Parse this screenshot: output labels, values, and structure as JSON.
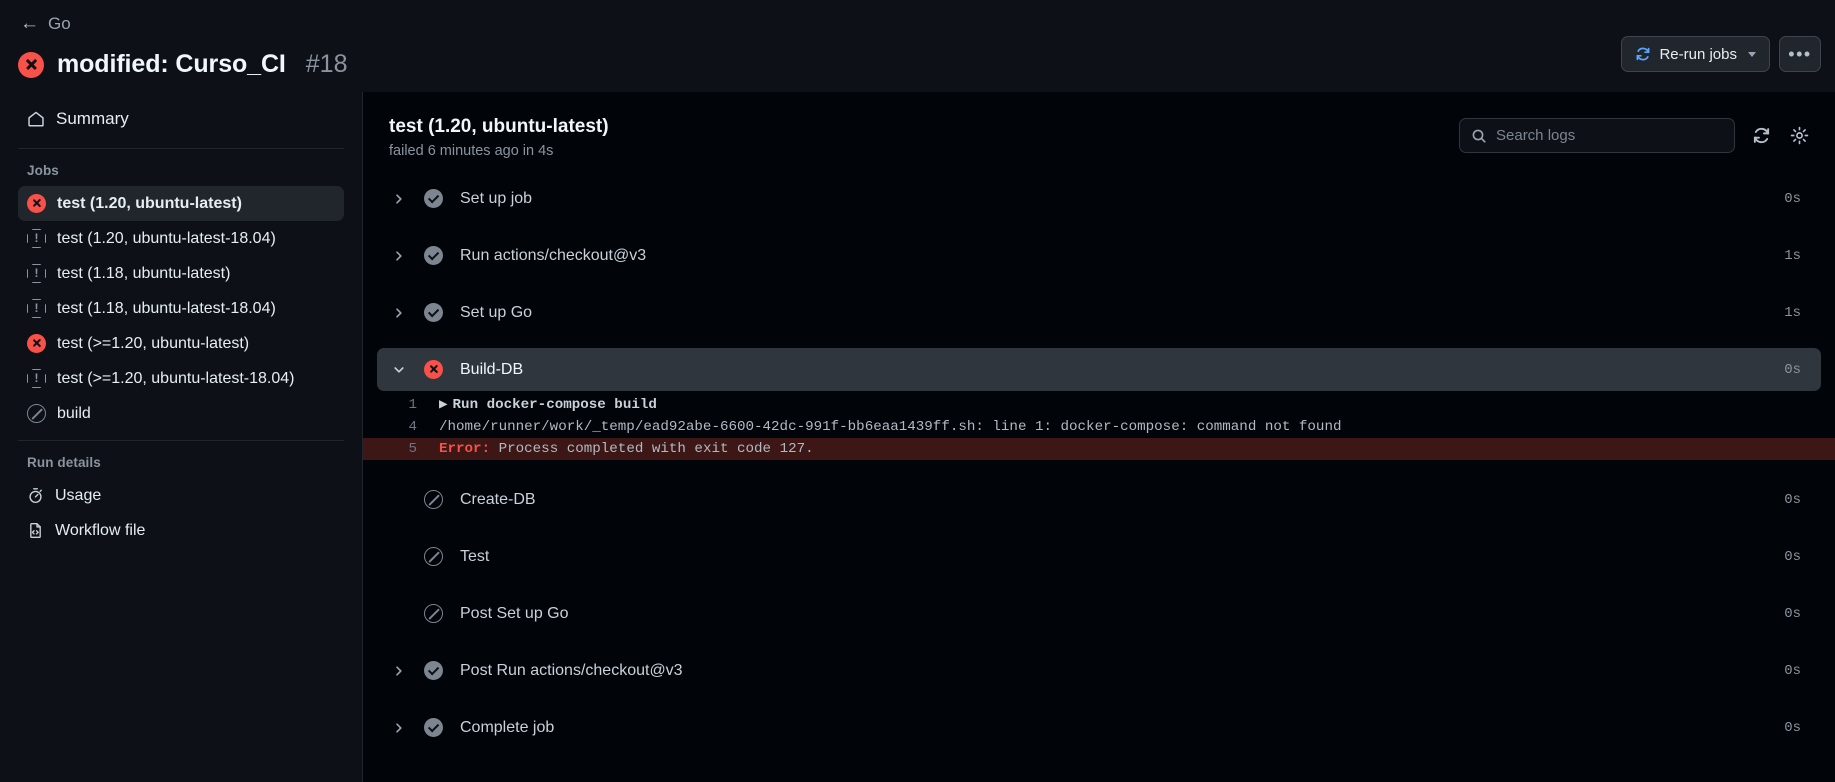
{
  "header": {
    "back_arrow_glyph": "←",
    "back_label": "Go",
    "run_title": "modified: Curso_CI",
    "run_number": "#18",
    "status_icon": "failure-x-icon",
    "rerun_button_label": "Re-run jobs",
    "rerun_icon": "refresh-icon",
    "overflow_button_label": "•••"
  },
  "sidebar": {
    "summary": {
      "label": "Summary",
      "icon": "home-icon"
    },
    "jobs_heading": "Jobs",
    "jobs": [
      {
        "label": "test (1.20, ubuntu-latest)",
        "status": "failure",
        "selected": true
      },
      {
        "label": "test (1.20, ubuntu-latest-18.04)",
        "status": "warning",
        "selected": false
      },
      {
        "label": "test (1.18, ubuntu-latest)",
        "status": "warning",
        "selected": false
      },
      {
        "label": "test (1.18, ubuntu-latest-18.04)",
        "status": "warning",
        "selected": false
      },
      {
        "label": "test (>=1.20, ubuntu-latest)",
        "status": "failure",
        "selected": false
      },
      {
        "label": "test (>=1.20, ubuntu-latest-18.04)",
        "status": "warning",
        "selected": false
      },
      {
        "label": "build",
        "status": "skipped",
        "selected": false
      }
    ],
    "run_details_heading": "Run details",
    "run_details": [
      {
        "label": "Usage",
        "icon": "stopwatch-icon"
      },
      {
        "label": "Workflow file",
        "icon": "code-file-icon"
      }
    ]
  },
  "main": {
    "job_title": "test (1.20, ubuntu-latest)",
    "job_subtitle": "failed 6 minutes ago in 4s",
    "search_placeholder": "Search logs",
    "search_value": "",
    "search_icon": "search-icon",
    "refresh_icon": "refresh-icon",
    "settings_icon": "gear-icon",
    "steps": [
      {
        "name": "Set up job",
        "status": "success",
        "duration": "0s",
        "expandable": true,
        "expanded": false
      },
      {
        "name": "Run actions/checkout@v3",
        "status": "success",
        "duration": "1s",
        "expandable": true,
        "expanded": false
      },
      {
        "name": "Set up Go",
        "status": "success",
        "duration": "1s",
        "expandable": true,
        "expanded": false
      },
      {
        "name": "Build-DB",
        "status": "failure",
        "duration": "0s",
        "expandable": true,
        "expanded": true
      },
      {
        "name": "Create-DB",
        "status": "skipped",
        "duration": "0s",
        "expandable": false,
        "expanded": false
      },
      {
        "name": "Test",
        "status": "skipped",
        "duration": "0s",
        "expandable": false,
        "expanded": false
      },
      {
        "name": "Post Set up Go",
        "status": "skipped",
        "duration": "0s",
        "expandable": false,
        "expanded": false
      },
      {
        "name": "Post Run actions/checkout@v3",
        "status": "success",
        "duration": "0s",
        "expandable": true,
        "expanded": false
      },
      {
        "name": "Complete job",
        "status": "success",
        "duration": "0s",
        "expandable": true,
        "expanded": false
      }
    ],
    "log_lines": [
      {
        "number": "1",
        "kind": "command",
        "marker": "▶",
        "text": "Run docker-compose build"
      },
      {
        "number": "4",
        "kind": "plain",
        "text": "/home/runner/work/_temp/ead92abe-6600-42dc-991f-bb6eaa1439ff.sh: line 1: docker-compose: command not found"
      },
      {
        "number": "5",
        "kind": "error",
        "error_label": "Error:",
        "text": " Process completed with exit code 127."
      }
    ]
  },
  "colors": {
    "failure_red": "#f85149",
    "error_bg": "#3d1715",
    "selected_bg": "#21262d",
    "expanded_bg": "#30363d",
    "page_bg": "#0d1117",
    "main_bg": "#010409"
  }
}
